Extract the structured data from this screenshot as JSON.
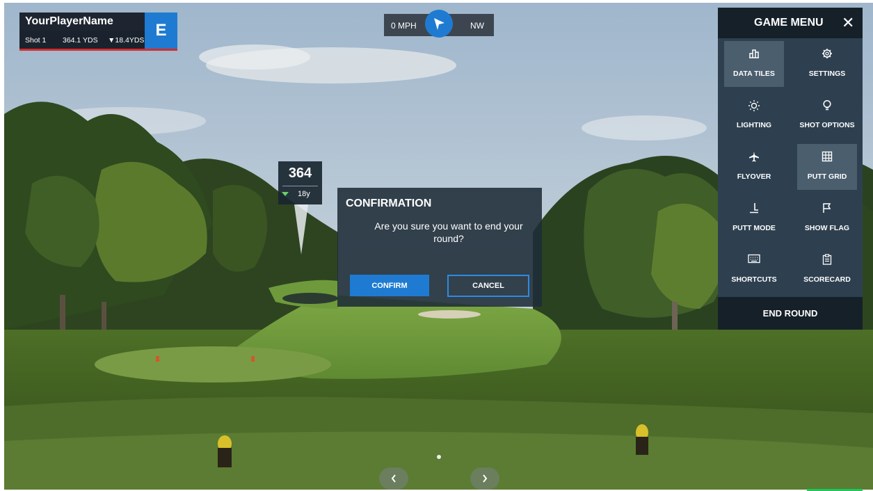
{
  "player": {
    "name": "YourPlayerName",
    "shot_label": "Shot 1",
    "distance": "364.1 YDS",
    "remaining": "▼18.4YDS",
    "badge": "E"
  },
  "wind": {
    "speed": "0 MPH",
    "direction": "NW",
    "icon": "wind-direction-arrow-icon"
  },
  "distance_marker": {
    "value": "364",
    "sub_value": "18y"
  },
  "dialog": {
    "title": "CONFIRMATION",
    "message": "Are you sure you want to end your round?",
    "confirm_label": "CONFIRM",
    "cancel_label": "CANCEL"
  },
  "menu": {
    "title": "GAME MENU",
    "close_icon": "close-icon",
    "items": [
      {
        "label": "DATA TILES",
        "icon": "data-tiles-icon",
        "active": true
      },
      {
        "label": "SETTINGS",
        "icon": "gear-icon",
        "active": false
      },
      {
        "label": "LIGHTING",
        "icon": "sun-icon",
        "active": false
      },
      {
        "label": "SHOT OPTIONS",
        "icon": "lightbulb-icon",
        "active": false
      },
      {
        "label": "FLYOVER",
        "icon": "airplane-icon",
        "active": false
      },
      {
        "label": "PUTT GRID",
        "icon": "grid-icon",
        "active": true
      },
      {
        "label": "PUTT MODE",
        "icon": "putter-icon",
        "active": false
      },
      {
        "label": "SHOW FLAG",
        "icon": "flag-icon",
        "active": false
      },
      {
        "label": "SHORTCUTS",
        "icon": "keyboard-icon",
        "active": false
      },
      {
        "label": "SCORECARD",
        "icon": "clipboard-icon",
        "active": false
      }
    ],
    "end_round_label": "END ROUND"
  },
  "nav": {
    "prev_icon": "chevron-left-icon",
    "next_icon": "chevron-right-icon"
  },
  "colors": {
    "accent": "#1f7bd1",
    "menu_bg": "#2e4050",
    "menu_header": "#162029",
    "player_underline": "#d62d2d"
  }
}
